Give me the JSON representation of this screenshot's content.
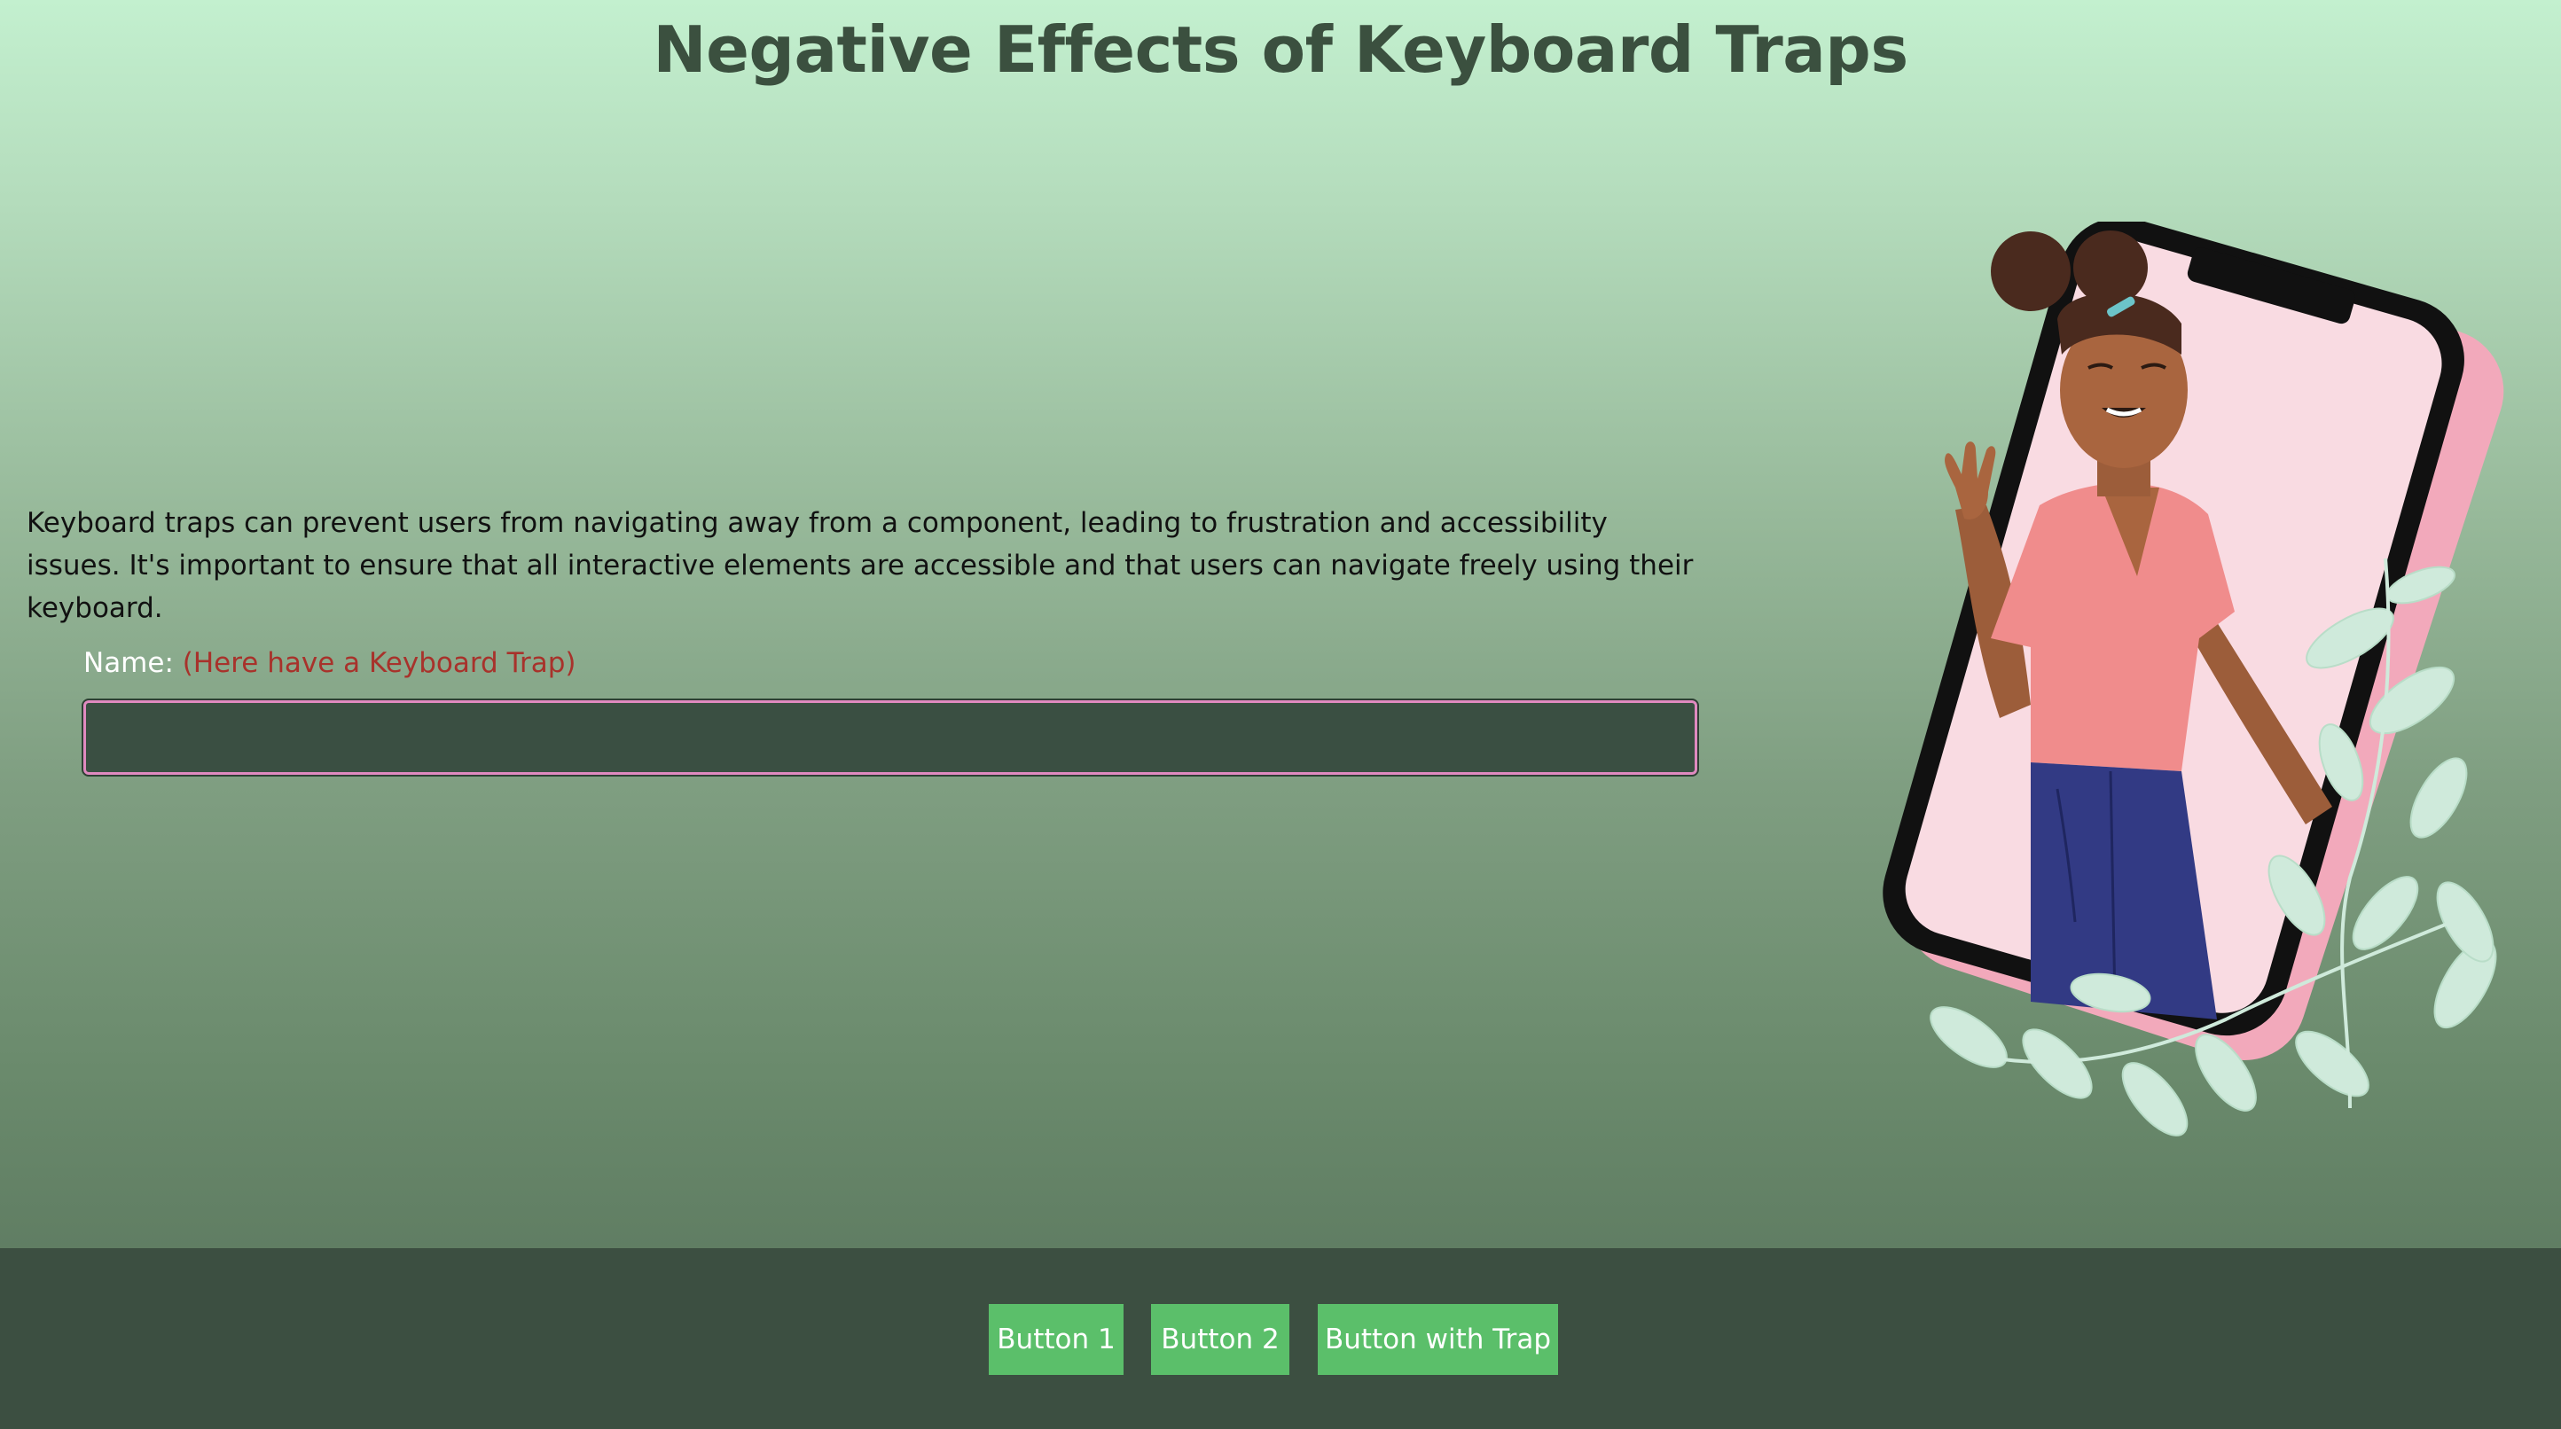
{
  "page": {
    "title": "Negative Effects of Keyboard Traps",
    "intro": "Keyboard traps can prevent users from navigating away from a component, leading to frustration and accessibility issues. It's important to ensure that all interactive elements are accessible and that users can navigate freely using their keyboard."
  },
  "form": {
    "name_label": "Name:",
    "name_hint": "(Here have a Keyboard Trap)",
    "name_value": ""
  },
  "illustration": {
    "icon": "woman-in-phone-illustration"
  },
  "footer": {
    "buttons": [
      {
        "label": "Button 1"
      },
      {
        "label": "Button 2"
      },
      {
        "label": "Button with Trap"
      }
    ]
  },
  "colors": {
    "title": "#3b503f",
    "footer_bg": "#3c4f41",
    "button_bg": "#5bbf6a",
    "hint": "#a8322b",
    "input_bg": "#3a4f42",
    "input_border": "#e08ac0"
  }
}
